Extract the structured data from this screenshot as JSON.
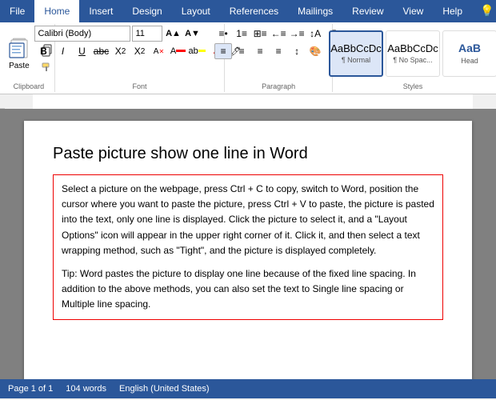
{
  "ribbon": {
    "tabs": [
      {
        "label": "File",
        "id": "file",
        "active": false
      },
      {
        "label": "Home",
        "id": "home",
        "active": true
      },
      {
        "label": "Insert",
        "id": "insert",
        "active": false
      },
      {
        "label": "Design",
        "id": "design",
        "active": false
      },
      {
        "label": "Layout",
        "id": "layout",
        "active": false
      },
      {
        "label": "References",
        "id": "references",
        "active": false
      },
      {
        "label": "Mailings",
        "id": "mailings",
        "active": false
      },
      {
        "label": "Review",
        "id": "review",
        "active": false
      },
      {
        "label": "View",
        "id": "view",
        "active": false
      },
      {
        "label": "Help",
        "id": "help",
        "active": false
      }
    ],
    "groups": {
      "clipboard": {
        "label": "Clipboard"
      },
      "font": {
        "label": "Font",
        "name_value": "Calibri (Body)",
        "size_value": "11",
        "bold": "B",
        "italic": "I",
        "underline": "U",
        "strikethrough": "abc",
        "subscript": "X₂",
        "superscript": "X²"
      },
      "paragraph": {
        "label": "Paragraph"
      },
      "styles": {
        "label": "Styles",
        "items": [
          {
            "label": "¶ Normal",
            "tag": "Normal",
            "active": true
          },
          {
            "label": "¶ No Spac...",
            "tag": "No Spac...",
            "active": false
          },
          {
            "label": "Head",
            "tag": "Head",
            "active": false
          }
        ]
      }
    }
  },
  "buttons": {
    "paste_label": "Paste",
    "cut": "✂",
    "copy": "📋",
    "format_painter": "🖌"
  },
  "document": {
    "title": "Paste picture show one line in Word",
    "body_paragraphs": [
      "Select a picture on the webpage, press Ctrl + C to copy, switch to Word, position the cursor where you want to paste the picture, press Ctrl + V to paste, the picture is pasted into the text, only one line is displayed. Click the picture to select it, and a \"Layout Options\" icon will appear in the upper right corner of it. Click it, and then select a text wrapping method, such as \"Tight\", and the picture is displayed completely.",
      "Tip: Word pastes the picture to display one line because of the fixed line spacing. In addition to the above methods, you can also set the text to Single line spacing or Multiple line spacing."
    ]
  },
  "status_bar": {
    "page": "Page 1 of 1",
    "words": "104 words",
    "language": "English (United States)"
  }
}
